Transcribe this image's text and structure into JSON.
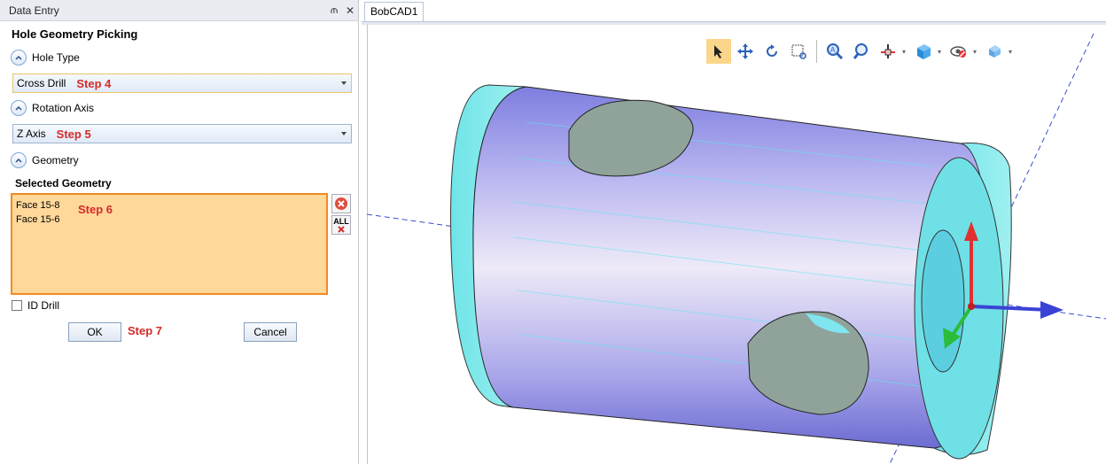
{
  "panel": {
    "title": "Data Entry",
    "pin_glyph": "⫙",
    "close_glyph": "✕",
    "heading": "Hole Geometry Picking",
    "hole_type_label": "Hole Type",
    "hole_type_value": "Cross Drill",
    "step4": "Step 4",
    "rotation_axis_label": "Rotation Axis",
    "rotation_axis_value": "Z Axis",
    "step5": "Step 5",
    "geometry_label": "Geometry",
    "selected_geometry_label": "Selected Geometry",
    "selected_items": [
      "Face 15-8",
      "Face 15-6"
    ],
    "step6": "Step 6",
    "id_drill_label": "ID Drill",
    "ok_label": "OK",
    "cancel_label": "Cancel",
    "step7": "Step 7",
    "remove_all_label": "ALL"
  },
  "document": {
    "tab_label": "BobCAD1"
  },
  "view_toolbar": {
    "icons": [
      "select-arrow-icon",
      "pan-icon",
      "rotate-icon",
      "zoom-window-icon",
      "zoom-in-icon",
      "zoom-fit-icon",
      "axis-triad-icon",
      "view-cube-icon",
      "visibility-icon",
      "wireframe-icon"
    ]
  },
  "colors": {
    "accent_orange": "#f08a22",
    "selection_fill": "#ffd89a",
    "step_red": "#d42a2a"
  }
}
